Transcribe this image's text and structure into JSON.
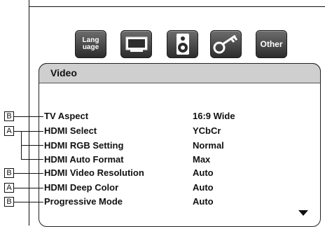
{
  "tabs": [
    {
      "label_line1": "Lang",
      "label_line2": "uage",
      "icon": "language-icon"
    },
    {
      "label": "",
      "icon": "display-icon"
    },
    {
      "label": "",
      "icon": "speaker-icon"
    },
    {
      "label": "",
      "icon": "key-icon"
    },
    {
      "label": "Other",
      "icon": "other-icon"
    }
  ],
  "panel": {
    "title": "Video",
    "rows": [
      {
        "label": "TV Aspect",
        "value": "16:9 Wide",
        "badge": "B"
      },
      {
        "label": "HDMI Select",
        "value": "YCbCr",
        "badge": "A"
      },
      {
        "label": "HDMI RGB Setting",
        "value": "Normal",
        "badge": ""
      },
      {
        "label": "HDMI Auto Format",
        "value": "Max",
        "badge": ""
      },
      {
        "label": "HDMI Video Resolution",
        "value": "Auto",
        "badge": "B"
      },
      {
        "label": "HDMI Deep Color",
        "value": "Auto",
        "badge": "A"
      },
      {
        "label": "Progressive Mode",
        "value": "Auto",
        "badge": "B"
      }
    ]
  }
}
